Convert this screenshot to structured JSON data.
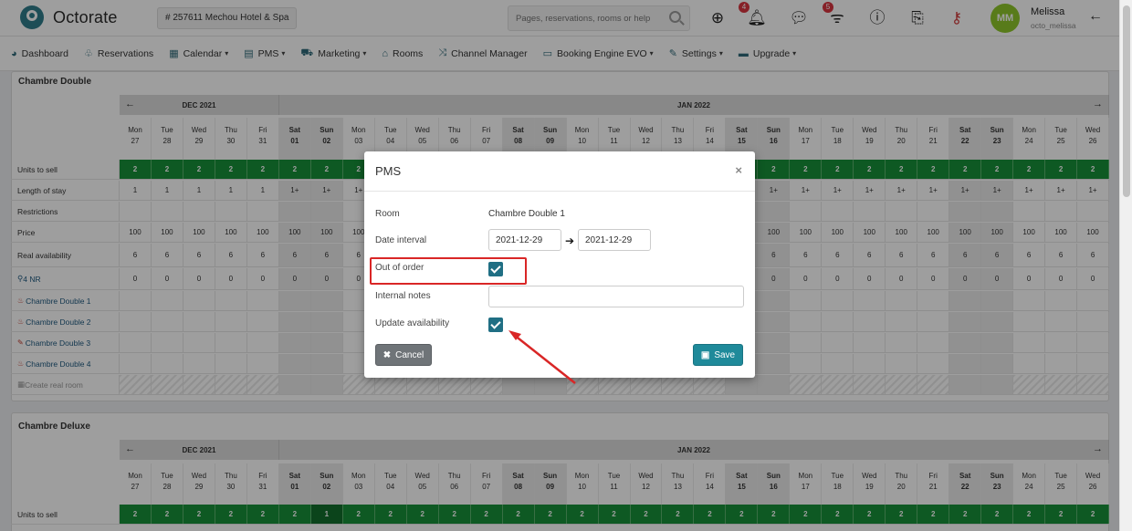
{
  "header": {
    "app_name": "Octorate",
    "hotel": "# 257611  Mechou Hotel & Spa",
    "search_placeholder": "Pages, reservations, rooms or help",
    "notifications_count": "4",
    "feed_count": "5",
    "user_initials": "MM",
    "user_name": "Melissa",
    "user_login": "octo_melissa"
  },
  "nav": {
    "items": [
      {
        "label": "Dashboard",
        "icon": "dashboard-icon",
        "caret": false
      },
      {
        "label": "Reservations",
        "icon": "handshake-icon",
        "caret": false
      },
      {
        "label": "Calendar",
        "icon": "calendar-icon",
        "caret": true
      },
      {
        "label": "PMS",
        "icon": "calendar-grid-icon",
        "caret": true
      },
      {
        "label": "Marketing",
        "icon": "cart-icon",
        "caret": true
      },
      {
        "label": "Rooms",
        "icon": "home-icon",
        "caret": false
      },
      {
        "label": "Channel Manager",
        "icon": "shuffle-icon",
        "caret": false
      },
      {
        "label": "Booking Engine EVO",
        "icon": "monitor-icon",
        "caret": true
      },
      {
        "label": "Settings",
        "icon": "wrench-icon",
        "caret": true
      },
      {
        "label": "Upgrade",
        "icon": "card-icon",
        "caret": true
      }
    ]
  },
  "calendar": {
    "months": [
      "DEC 2021",
      "JAN 2022"
    ],
    "days": [
      {
        "d": "Mon",
        "n": "27",
        "we": false
      },
      {
        "d": "Tue",
        "n": "28",
        "we": false
      },
      {
        "d": "Wed",
        "n": "29",
        "we": false
      },
      {
        "d": "Thu",
        "n": "30",
        "we": false
      },
      {
        "d": "Fri",
        "n": "31",
        "we": false
      },
      {
        "d": "Sat",
        "n": "01",
        "we": true
      },
      {
        "d": "Sun",
        "n": "02",
        "we": true
      },
      {
        "d": "Mon",
        "n": "03",
        "we": false
      },
      {
        "d": "Tue",
        "n": "04",
        "we": false
      },
      {
        "d": "Wed",
        "n": "05",
        "we": false
      },
      {
        "d": "Thu",
        "n": "06",
        "we": false
      },
      {
        "d": "Fri",
        "n": "07",
        "we": false
      },
      {
        "d": "Sat",
        "n": "08",
        "we": true
      },
      {
        "d": "Sun",
        "n": "09",
        "we": true
      },
      {
        "d": "Mon",
        "n": "10",
        "we": false
      },
      {
        "d": "Tue",
        "n": "11",
        "we": false
      },
      {
        "d": "Wed",
        "n": "12",
        "we": false
      },
      {
        "d": "Thu",
        "n": "13",
        "we": false
      },
      {
        "d": "Fri",
        "n": "14",
        "we": false
      },
      {
        "d": "Sat",
        "n": "15",
        "we": true
      },
      {
        "d": "Sun",
        "n": "16",
        "we": true
      },
      {
        "d": "Mon",
        "n": "17",
        "we": false
      },
      {
        "d": "Tue",
        "n": "18",
        "we": false
      },
      {
        "d": "Wed",
        "n": "19",
        "we": false
      },
      {
        "d": "Thu",
        "n": "20",
        "we": false
      },
      {
        "d": "Fri",
        "n": "21",
        "we": false
      },
      {
        "d": "Sat",
        "n": "22",
        "we": true
      },
      {
        "d": "Sun",
        "n": "23",
        "we": true
      },
      {
        "d": "Mon",
        "n": "24",
        "we": false
      },
      {
        "d": "Tue",
        "n": "25",
        "we": false
      },
      {
        "d": "Wed",
        "n": "26",
        "we": false
      }
    ]
  },
  "rooms": [
    {
      "title": "Chambre Double",
      "rows": {
        "units_label": "Units to sell",
        "units": "2",
        "units_special": "1",
        "stay_label": "Length of stay",
        "stay_values": [
          "1",
          "1",
          "1",
          "1",
          "1",
          "1+",
          "1+",
          "1+",
          "1+",
          "1+",
          "1+",
          "1+",
          "1+",
          "1+",
          "1+",
          "1+",
          "1+",
          "1+",
          "1+",
          "1+",
          "1+",
          "1+",
          "1+",
          "1+",
          "1+",
          "1+",
          "1+",
          "1+",
          "1+",
          "1+",
          "1+"
        ],
        "restrictions_label": "Restrictions",
        "price_label": "Price",
        "price": "100",
        "avail_label": "Real availability",
        "avail": "6",
        "nr_label": "4  NR",
        "nr": "0",
        "room_units": [
          "Chambre Double 1",
          "Chambre Double 2",
          "Chambre Double 3",
          "Chambre Double 4"
        ],
        "create_label": "Create real room"
      }
    },
    {
      "title": "Chambre Deluxe",
      "rows": {
        "units_label": "Units to sell",
        "units": "2",
        "units_special": "1"
      }
    }
  ],
  "modal": {
    "title": "PMS",
    "room_label": "Room",
    "room_value": "Chambre Double 1",
    "date_label": "Date interval",
    "date_from": "2021-12-29",
    "date_to": "2021-12-29",
    "out_of_order_label": "Out of order",
    "out_of_order_checked": true,
    "notes_label": "Internal notes",
    "notes_value": "",
    "update_label": "Update availability",
    "update_checked": true,
    "cancel_label": "Cancel",
    "save_label": "Save"
  },
  "colors": {
    "accent": "#1f8a9a",
    "green": "#179039",
    "highlight_red": "#d92626"
  }
}
